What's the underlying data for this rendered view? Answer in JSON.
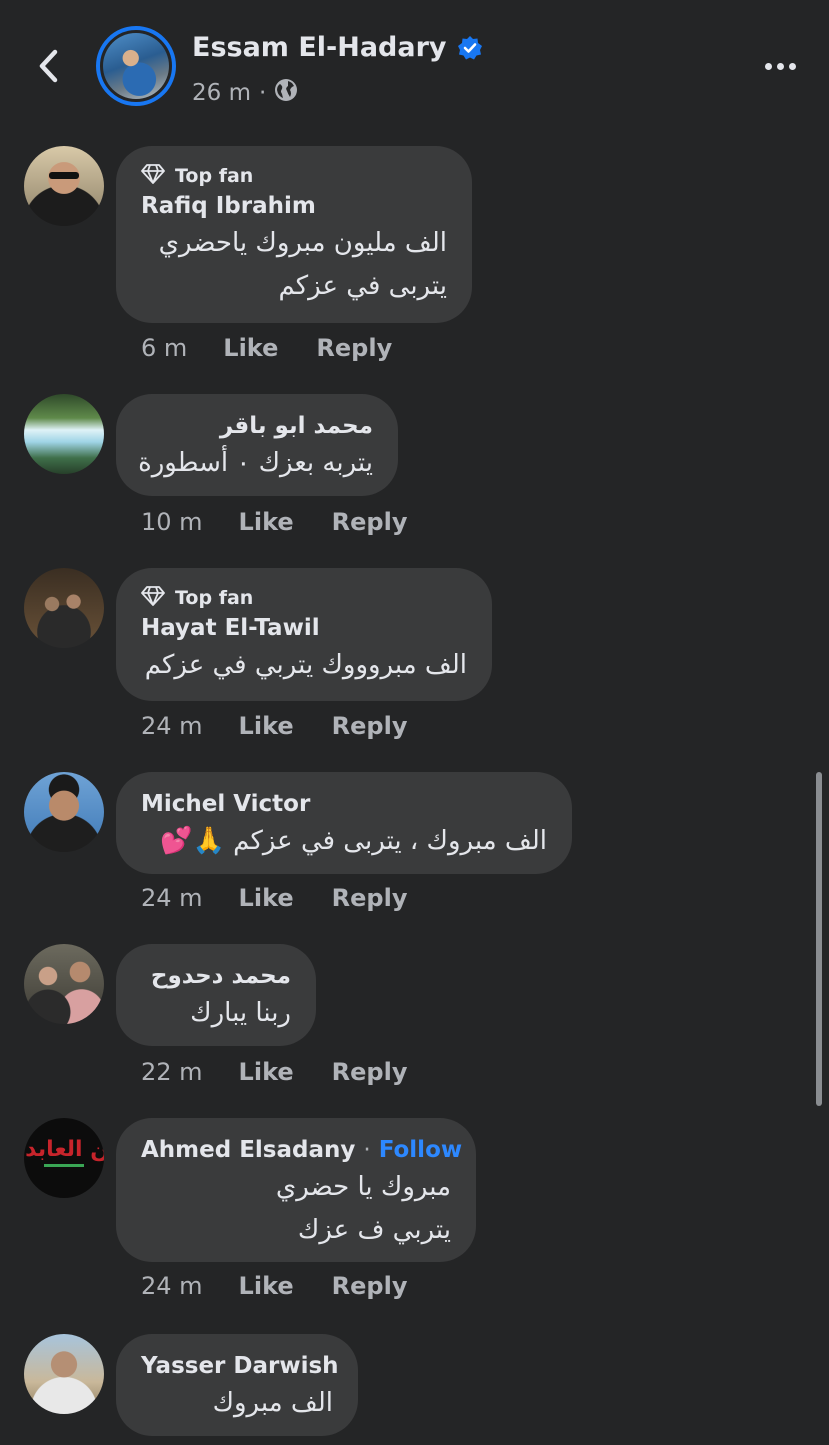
{
  "header": {
    "page_name": "Essam El-Hadary",
    "time": "26 m",
    "separator": "·"
  },
  "comments": [
    {
      "badge": "Top fan",
      "author": "Rafiq Ibrahim",
      "lines": [
        "الف مليون مبروك ياحضري",
        "يتربى في عزكم"
      ],
      "time": "6 m",
      "like": "Like",
      "reply": "Reply"
    },
    {
      "author": "محمد ابو باقر",
      "lines": [
        "يتربه بعزك ٠ أسطورة"
      ],
      "time": "10 m",
      "like": "Like",
      "reply": "Reply"
    },
    {
      "badge": "Top fan",
      "author": "Hayat El-Tawil",
      "lines": [
        "الف مبروووك يتربي في عزكم"
      ],
      "time": "24 m",
      "like": "Like",
      "reply": "Reply"
    },
    {
      "author": "Michel Victor",
      "lines": [
        "الف مبروك ، يتربى في عزكم 🙏💕"
      ],
      "time": "24 m",
      "like": "Like",
      "reply": "Reply"
    },
    {
      "author": "محمد دحدوح",
      "lines": [
        "ربنا يبارك"
      ],
      "time": "22 m",
      "like": "Like",
      "reply": "Reply"
    },
    {
      "author": "Ahmed Elsadany",
      "follow_sep": "·",
      "follow": "Follow",
      "lines": [
        "مبروك يا حضري",
        "يتربي ف عزك"
      ],
      "time": "24 m",
      "like": "Like",
      "reply": "Reply"
    },
    {
      "author": "Yasser Darwish",
      "lines": [
        "الف مبروك"
      ]
    }
  ],
  "avatar_logo_text": "زين العابدين",
  "colors": {
    "background": "#242526",
    "bubble": "#3a3b3c",
    "primary_text": "#e4e6eb",
    "secondary_text": "#b0b3b8",
    "accent_blue": "#1877f2",
    "follow_blue": "#2d88ff"
  },
  "icons": [
    "back-arrow-icon",
    "verified-badge-icon",
    "globe-icon",
    "more-options-icon",
    "diamond-icon"
  ]
}
